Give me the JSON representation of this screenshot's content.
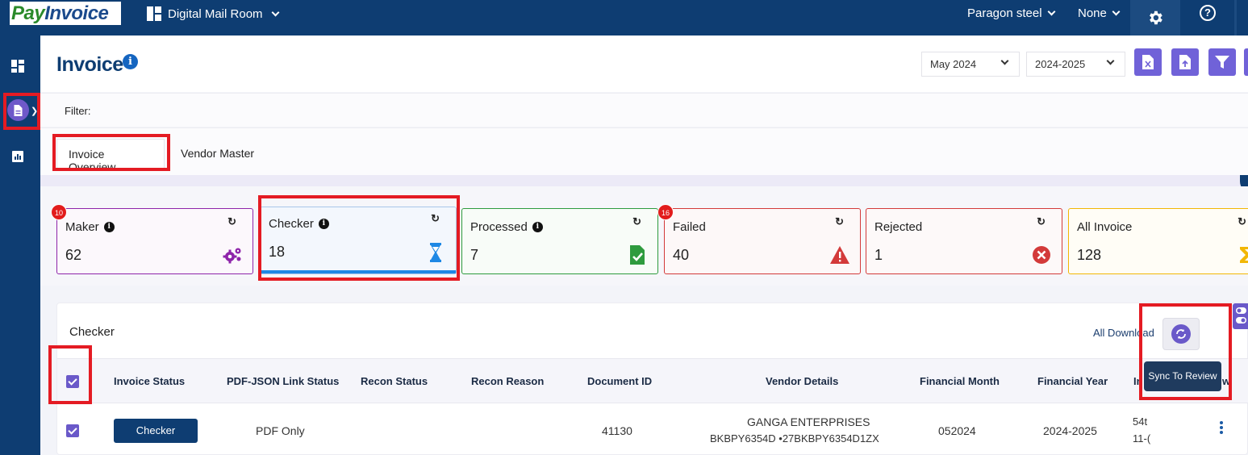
{
  "topbar": {
    "logo_part1": "Pay",
    "logo_part2": "Invoice",
    "app_name": "Digital Mail Room",
    "company": "Paragon steel",
    "branch": "None"
  },
  "page": {
    "title": "Invoice"
  },
  "filters": {
    "month": "May 2024",
    "year": "2024-2025",
    "label": "Filter:"
  },
  "tabs": [
    {
      "label": "Invoice Overview",
      "active": true
    },
    {
      "label": "Vendor Master",
      "active": false
    }
  ],
  "cards": [
    {
      "label": "Maker",
      "count": "62",
      "badge": "10",
      "color": "#8e24aa",
      "bg": "#fcf8fc"
    },
    {
      "label": "Checker",
      "count": "18",
      "badge": "",
      "color": "#1e88e5",
      "bg": "#f3f7fd"
    },
    {
      "label": "Processed",
      "count": "7",
      "badge": "",
      "color": "#2e9b3e",
      "bg": "#f8fcf8"
    },
    {
      "label": "Failed",
      "count": "40",
      "badge": "16",
      "color": "#d33a3a",
      "bg": "#fdf8f8"
    },
    {
      "label": "Rejected",
      "count": "1",
      "badge": "",
      "color": "#d33a3a",
      "bg": "#fdf9f9"
    },
    {
      "label": "All Invoice",
      "count": "128",
      "badge": "",
      "color": "#f2b705",
      "bg": "#fffdf6"
    }
  ],
  "table": {
    "title": "Checker",
    "all_download": "All Download",
    "tooltip": "Sync To Review",
    "columns": [
      "Invoice Status",
      "PDF-JSON Link Status",
      "Recon Status",
      "Recon Reason",
      "Document ID",
      "Vendor Details",
      "Financial Month",
      "Financial Year",
      "In",
      "w"
    ],
    "rows": [
      {
        "status": "Checker",
        "pdf_json": "PDF Only",
        "document_id": "41130",
        "vendor_name": "GANGA ENTERPRISES",
        "vendor_ids": "BKBPY6354D  •27BKBPY6354D1ZX",
        "fin_month": "052024",
        "fin_year": "2024-2025",
        "inv_line1": "54t",
        "inv_line2": "11-("
      }
    ]
  }
}
